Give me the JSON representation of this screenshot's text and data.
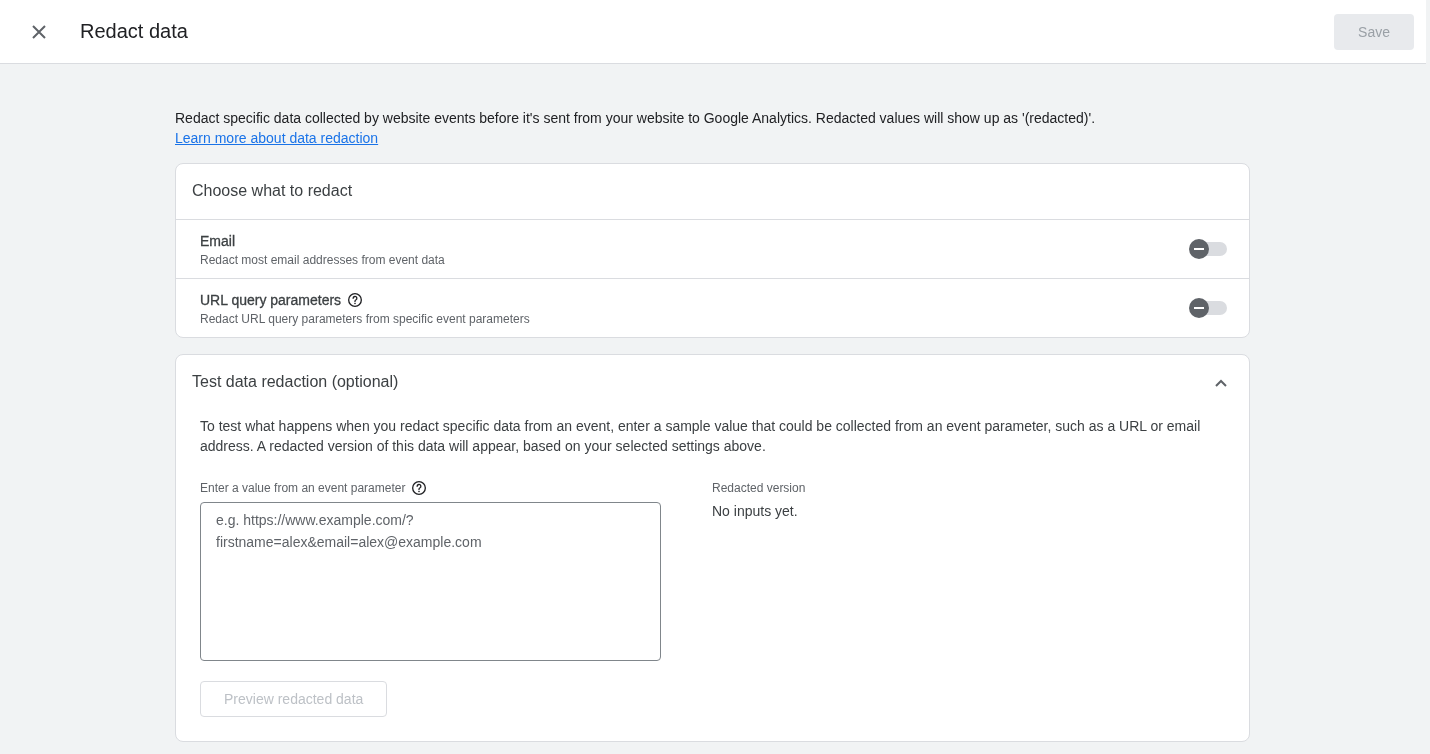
{
  "header": {
    "title": "Redact data",
    "save_button": {
      "label": "Save",
      "disabled": true
    }
  },
  "intro": {
    "text": "Redact specific data collected by website events before it's sent from your website to Google Analytics. Redacted values will show up as '(redacted)'. ",
    "link": "Learn more about data redaction"
  },
  "redact_card": {
    "title": "Choose what to redact",
    "options": [
      {
        "label": "Email",
        "description": "Redact most email addresses from event data",
        "help": false,
        "on": false
      },
      {
        "label": "URL query parameters",
        "description": "Redact URL query parameters from specific event parameters",
        "help": true,
        "on": false
      }
    ]
  },
  "test_card": {
    "title": "Test data redaction (optional)",
    "expanded": true,
    "description": "To test what happens when you redact specific data from an event, enter a sample value that could be collected from an event parameter, such as a URL or email address. A redacted version of this data will appear, based on your selected settings above.",
    "input_label": "Enter a value from an event parameter",
    "input_placeholder": "e.g. https://www.example.com/?\nfirstname=alex&email=alex@example.com",
    "result_label": "Redacted version",
    "result_text": "No inputs yet.",
    "preview_button": {
      "label": "Preview redacted data",
      "disabled": true
    }
  }
}
